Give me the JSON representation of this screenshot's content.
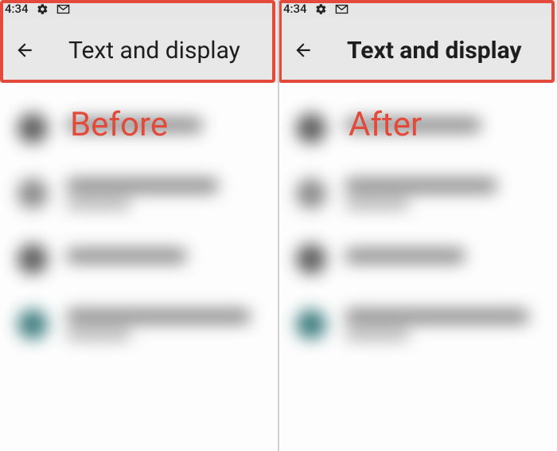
{
  "left": {
    "statusbar": {
      "time": "4:34"
    },
    "appbar": {
      "title": "Text and display"
    },
    "caption": "Before"
  },
  "right": {
    "statusbar": {
      "time": "4:34"
    },
    "appbar": {
      "title": "Text and display"
    },
    "caption": "After"
  },
  "icons": {
    "gear": "gear-icon",
    "gmail": "gmail-icon",
    "back": "back-arrow-icon"
  },
  "colors": {
    "highlight": "#e24a3b",
    "appbar_bg": "#e8e8e8"
  }
}
